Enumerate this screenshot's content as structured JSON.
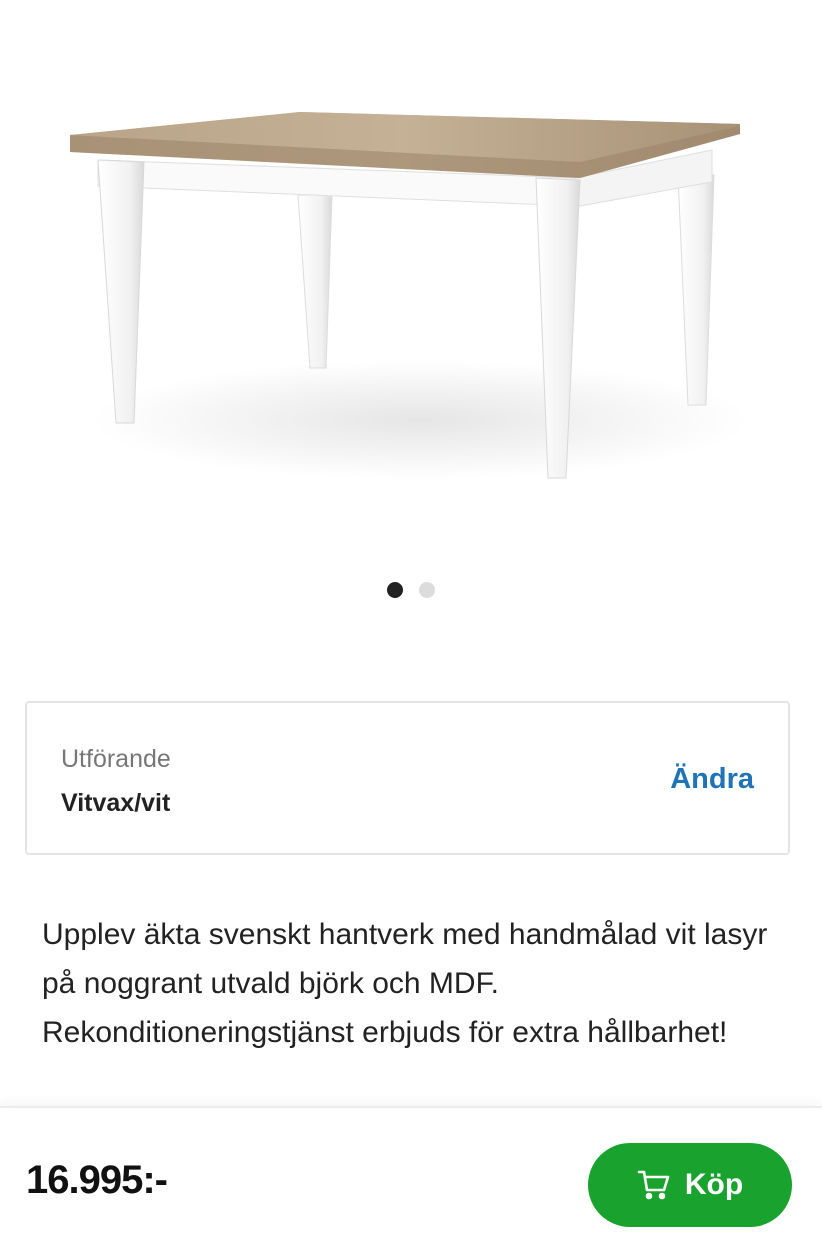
{
  "gallery": {
    "image_alt": "Matbord med vitvaxad bordsskiva och vita ben",
    "dots": 2,
    "active_index": 0
  },
  "variant": {
    "label": "Utförande",
    "value": "Vitvax/vit",
    "change_label": "Ändra"
  },
  "description": {
    "text": "Upplev äkta svenskt hantverk med handmålad vit lasyr på noggrant utvald björk och MDF. Rekonditioneringstjänst erbjuds för extra hållbarhet!"
  },
  "purchase": {
    "price": "16.995:-",
    "buy_label": "Köp",
    "buy_icon": "cart-icon"
  },
  "colors": {
    "accent_green": "#1aa22e",
    "link_blue": "#1f73b7"
  }
}
